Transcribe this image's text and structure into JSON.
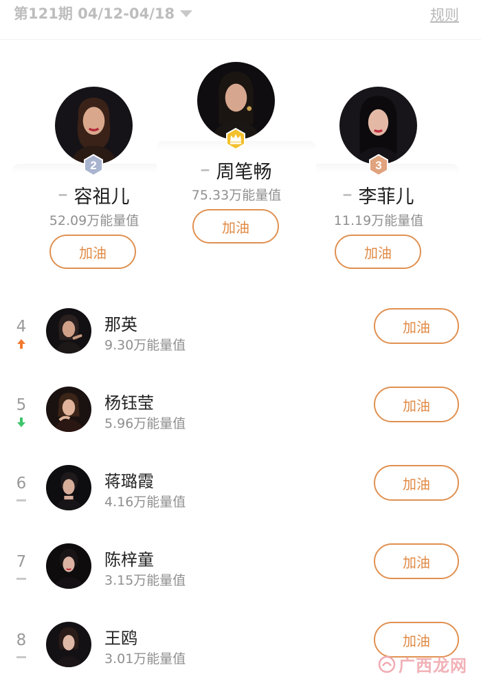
{
  "header": {
    "period": "第121期 04/12-04/18",
    "rules_label": "规则"
  },
  "podium": [
    {
      "rank": "2",
      "name": "容祖儿",
      "energy": "52.09万能量值",
      "cheer_label": "加油",
      "badge_color": "#a9b4cf"
    },
    {
      "rank": "1",
      "name": "周笔畅",
      "energy": "75.33万能量值",
      "cheer_label": "加油",
      "badge_color": "#f3c12e",
      "badge_icon": "crown-icon"
    },
    {
      "rank": "3",
      "name": "李菲儿",
      "energy": "11.19万能量值",
      "cheer_label": "加油",
      "badge_color": "#e0a37e"
    }
  ],
  "list": [
    {
      "rank": "4",
      "trend": "up",
      "name": "那英",
      "energy": "9.30万能量值",
      "cheer_label": "加油"
    },
    {
      "rank": "5",
      "trend": "down",
      "name": "杨钰莹",
      "energy": "5.96万能量值",
      "cheer_label": "加油"
    },
    {
      "rank": "6",
      "trend": "flat",
      "name": "蒋璐霞",
      "energy": "4.16万能量值",
      "cheer_label": "加油"
    },
    {
      "rank": "7",
      "trend": "flat",
      "name": "陈梓童",
      "energy": "3.15万能量值",
      "cheer_label": "加油"
    },
    {
      "rank": "8",
      "trend": "flat",
      "name": "王鸥",
      "energy": "3.01万能量值",
      "cheer_label": "加油"
    }
  ],
  "colors": {
    "accent": "#e09050",
    "trend_up": "#f07a30",
    "trend_down": "#3cc46a",
    "muted": "#8f8f8f"
  },
  "watermark": {
    "text": "广西龙网"
  }
}
